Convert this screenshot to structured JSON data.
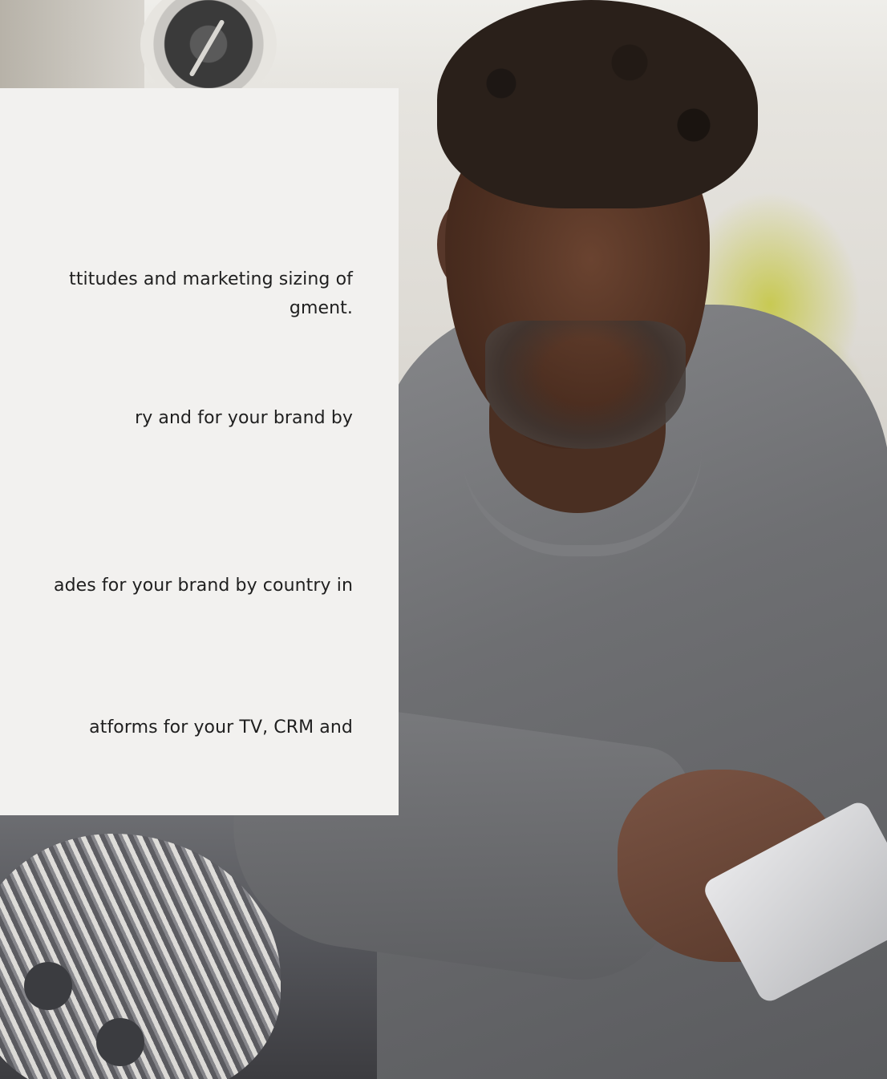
{
  "panel": {
    "lines": [
      "ttitudes and marketing sizing of",
      "gment.",
      "ry and for your brand by",
      "ades for your brand by country in",
      "atforms for your TV, CRM and"
    ]
  },
  "photo": {
    "description_tag": "man-using-tablet-on-sofa"
  },
  "colors": {
    "panel_background": "#f2f1ef",
    "text": "#1f1f1f"
  }
}
